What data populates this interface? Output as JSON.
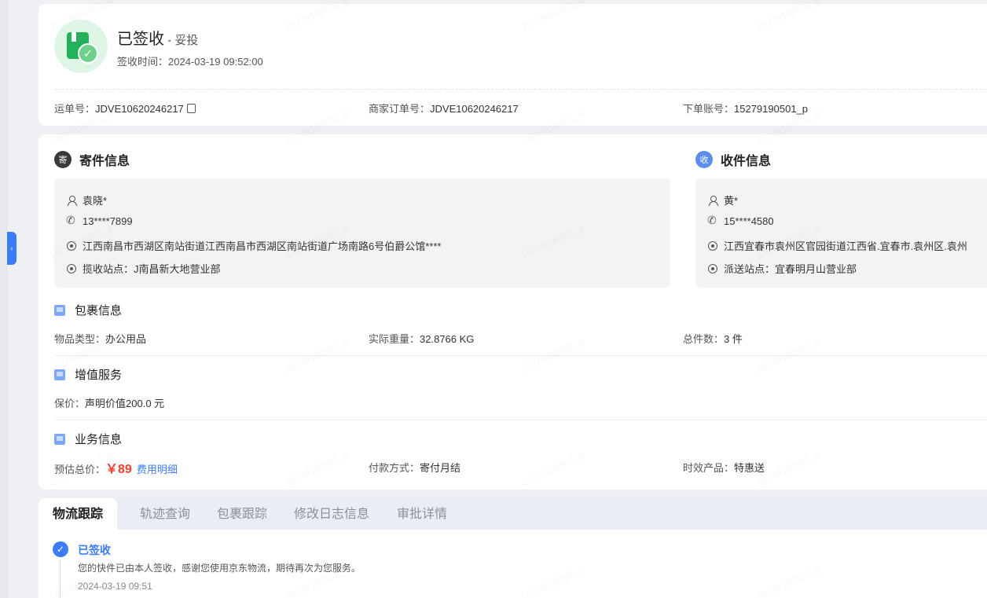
{
  "sidebar": {
    "collapse_glyph": "‹"
  },
  "status": {
    "title": "已签收",
    "subtitle": " - 妥投",
    "time_label": "签收时间：",
    "time_value": "2024-03-19 09:52:00",
    "check_glyph": "✓"
  },
  "order_meta": {
    "waybill_label": "运单号：",
    "waybill_value": "JDVE10620246217",
    "merchant_label": "商家订单号：",
    "merchant_value": "JDVE10620246217",
    "account_label": "下单账号：",
    "account_value": "15279190501_p"
  },
  "sender": {
    "badge": "寄",
    "heading": "寄件信息",
    "badge_color": "#3a3a3a",
    "name": "袁晓*",
    "phone": "13****7899",
    "address": "江西南昌市西湖区南站街道江西南昌市西湖区南站街道广场南路6号伯爵公馆****",
    "station": "揽收站点：J南昌新大地营业部"
  },
  "receiver": {
    "badge": "收",
    "heading": "收件信息",
    "badge_color": "#5b8def",
    "name": "黄*",
    "phone": "15****4580",
    "address": "江西宜春市袁州区官园街道江西省.宜春市.袁州区.袁州",
    "station": "派送站点：宜春明月山营业部"
  },
  "package": {
    "heading": "包裹信息",
    "type_label": "物品类型：",
    "type_value": "办公用品",
    "weight_label": "实际重量：",
    "weight_value": "32.8766 KG",
    "count_label": "总件数：",
    "count_value": "3 件"
  },
  "value_added": {
    "heading": "增值服务",
    "insurance_label": "保价：",
    "insurance_value": "声明价值200.0 元"
  },
  "business": {
    "heading": "业务信息",
    "price_label": "预估总价：",
    "price_value": "￥89",
    "fee_link": "费用明细",
    "payment_label": "付款方式：",
    "payment_value": "寄付月结",
    "product_label": "时效产品：",
    "product_value": "特惠送"
  },
  "tracking": {
    "tabs": [
      "物流跟踪",
      "轨迹查询",
      "包裹跟踪",
      "修改日志信息",
      "审批详情"
    ],
    "entry_title": "已签收",
    "entry_desc": "您的快件已由本人签收，感谢您使用京东物流，期待再次为您服务。",
    "entry_time": "2024-03-19 09:51",
    "check_glyph": "✓"
  },
  "watermark_text": "15279190501_p"
}
